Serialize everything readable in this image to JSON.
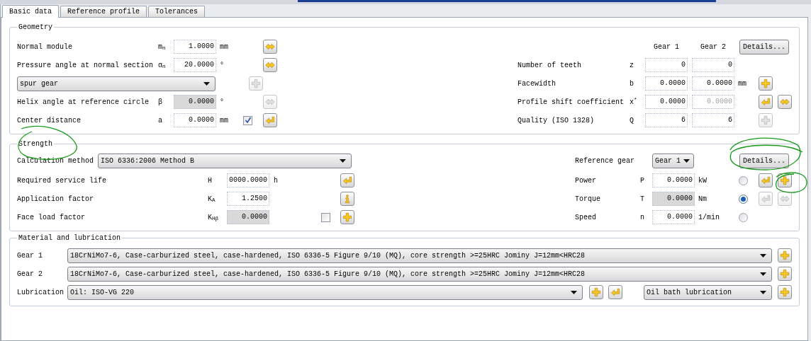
{
  "tabs": [
    {
      "label": "Basic data",
      "selected": true
    },
    {
      "label": "Reference profile",
      "selected": false
    },
    {
      "label": "Tolerances",
      "selected": false
    }
  ],
  "geometry": {
    "title": "Geometry",
    "rows": [
      {
        "kind": "field",
        "label": "Normal module",
        "symbol": "m$_{n}$",
        "value": "1.0000",
        "readonly": false,
        "unit": "mm",
        "buttons": [
          {
            "kind": "swap",
            "disabled": false
          }
        ]
      },
      {
        "kind": "field",
        "label": "Pressure angle at normal section",
        "symbol": "α$_{n}$",
        "value": "20.0000",
        "readonly": false,
        "unit": "°",
        "buttons": [
          {
            "kind": "swap",
            "disabled": false
          }
        ]
      },
      {
        "kind": "select",
        "value": "spur gear",
        "buttons": [
          {
            "kind": "plus",
            "disabled": true
          }
        ]
      },
      {
        "kind": "field",
        "label": "Helix angle at reference circle",
        "symbol": "β",
        "value": "0.0000",
        "readonly": true,
        "unit": "°",
        "buttons": [
          {
            "kind": "swap",
            "disabled": true
          }
        ]
      },
      {
        "kind": "field",
        "label": "Center distance",
        "symbol": "a",
        "value": "0.0000",
        "readonly": false,
        "unit": "mm",
        "checkbox": {
          "checked": true
        },
        "buttons": [
          {
            "kind": "enter",
            "disabled": false
          }
        ]
      }
    ],
    "gear_table": {
      "columns": [
        "Gear 1",
        "Gear 2"
      ],
      "details_button": "Details...",
      "rows": [
        {
          "label": "Number of teeth",
          "symbol": "z",
          "values": [
            {
              "value": "0",
              "disabled": false
            },
            {
              "value": "0",
              "disabled": false
            }
          ],
          "buttons": []
        },
        {
          "label": "Facewidth",
          "symbol": "b",
          "values": [
            {
              "value": "0.0000",
              "disabled": false
            },
            {
              "value": "0.0000",
              "disabled": false
            }
          ],
          "unit": "mm",
          "buttons": [
            {
              "kind": "plus",
              "disabled": false
            }
          ]
        },
        {
          "label": "Profile shift coefficient",
          "symbol": "x$^{*}$",
          "values": [
            {
              "value": "0.0000",
              "disabled": false
            },
            {
              "value": "0.0000",
              "disabled": true
            }
          ],
          "buttons": [
            {
              "kind": "enter",
              "disabled": false
            },
            {
              "kind": "swap",
              "disabled": false
            }
          ]
        },
        {
          "label": "Quality (ISO 1328)",
          "symbol": "Q",
          "values": [
            {
              "value": "6",
              "disabled": false
            },
            {
              "value": "6",
              "disabled": false
            }
          ],
          "buttons": [
            {
              "kind": "plus",
              "disabled": true
            }
          ]
        }
      ]
    }
  },
  "strength": {
    "title": "Strength",
    "calculation_method": {
      "label": "Calculation method",
      "value": "ISO 6336:2006 Method B"
    },
    "reference_gear": {
      "label": "Reference gear",
      "value": "Gear 1"
    },
    "details_button": "Details...",
    "rows": [
      {
        "label": "Required service life",
        "symbol": "H",
        "value": "0000.0000",
        "readonly": false,
        "unit": "h",
        "buttons": [
          {
            "kind": "enter",
            "disabled": false
          }
        ]
      },
      {
        "label": "Application factor",
        "symbol": "K$_{A}$",
        "value": "1.2500",
        "readonly": false,
        "buttons": [
          {
            "kind": "info",
            "disabled": false
          }
        ]
      },
      {
        "label": "Face load factor",
        "symbol": "K$_{Hβ}$",
        "value": "0.0000",
        "readonly": true,
        "checkbox": {
          "checked": false
        },
        "buttons": [
          {
            "kind": "plus",
            "disabled": false
          }
        ]
      }
    ],
    "load_rows": [
      {
        "label": "Power",
        "symbol": "P",
        "value": "0.0000",
        "readonly": false,
        "unit": "kW",
        "selected": false,
        "buttons": [
          {
            "kind": "enter",
            "disabled": false
          },
          {
            "kind": "plus",
            "disabled": false
          }
        ]
      },
      {
        "label": "Torque",
        "symbol": "T",
        "value": "0.0000",
        "readonly": true,
        "unit": "Nm",
        "selected": true,
        "buttons": [
          {
            "kind": "enter",
            "disabled": true
          },
          {
            "kind": "swap",
            "disabled": true
          }
        ]
      },
      {
        "label": "Speed",
        "symbol": "n",
        "value": "0.0000",
        "readonly": false,
        "unit": "1/min",
        "selected": false,
        "buttons": []
      }
    ]
  },
  "material": {
    "title": "Material and lubrication",
    "rows": [
      {
        "label": "Gear 1",
        "value": "18CrNiMo7-6, Case-carburized steel, case-hardened, ISO 6336-5 Figure 9/10 (MQ), core strength >=25HRC Jominy J=12mm<HRC28",
        "buttons": [
          {
            "kind": "plus",
            "disabled": false
          }
        ]
      },
      {
        "label": "Gear 2",
        "value": "18CrNiMo7-6, Case-carburized steel, case-hardened, ISO 6336-5 Figure 9/10 (MQ), core strength >=25HRC Jominy J=12mm<HRC28",
        "buttons": [
          {
            "kind": "plus",
            "disabled": false
          }
        ]
      }
    ],
    "lubrication": {
      "label": "Lubrication",
      "value": "Oil: ISO-VG 220",
      "buttons": [
        {
          "kind": "plus",
          "disabled": false
        },
        {
          "kind": "enter",
          "disabled": false
        }
      ],
      "method": "Oil bath lubrication",
      "method_buttons": [
        {
          "kind": "plus",
          "disabled": false
        }
      ]
    }
  }
}
